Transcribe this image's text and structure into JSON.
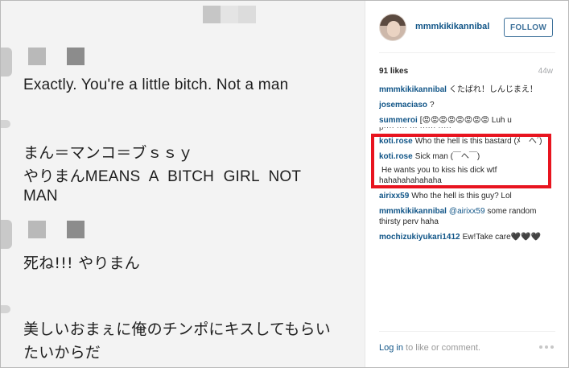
{
  "photo": {
    "lines": [
      "Exactly. You're a little bitch. Not a man",
      "まん＝マンコ＝ブｓｓｙ",
      "やりまんMEANS  A  BITCH  GIRL  NOT",
      "MAN",
      "死ね!!! やりまん",
      "美しいおまぇに俺のチンポにキスしてもらい",
      "たいからだ"
    ]
  },
  "post": {
    "owner": "mmmkikikannibal",
    "follow_label": "FOLLOW",
    "likes": "91 likes",
    "age": "44w"
  },
  "comments": [
    {
      "user": "mmmkikikannibal",
      "text": "くたばれ！しんじまえ！"
    },
    {
      "user": "josemaciaso",
      "text": "?"
    },
    {
      "user": "summeroi",
      "text": "[😡😡😡😡😡😡😡😡 Luh u"
    },
    {
      "user": "koti.rose",
      "text": "Who the hell is this bastard (ﾒ｀へ´)"
    },
    {
      "user": "koti.rose",
      "text": "Sick man (￣へ￣)"
    },
    {
      "user": "",
      "text": "He wants you to kiss his dick wtf hahahahahahaha"
    },
    {
      "user": "airixx59",
      "text": "Who the hell is this guy? Lol"
    },
    {
      "user": "mmmkikikannibal",
      "mention": "@airixx59",
      "text": "some random thirsty perv haha"
    },
    {
      "user": "mochizukiyukari1412",
      "text": "Ew!Take care🖤🖤🖤"
    }
  ],
  "footer": {
    "login_link": "Log in",
    "login_rest": "to like or comment."
  },
  "colors": {
    "link": "#125688",
    "follow": "#3f729b",
    "highlight": "#e8141f"
  }
}
